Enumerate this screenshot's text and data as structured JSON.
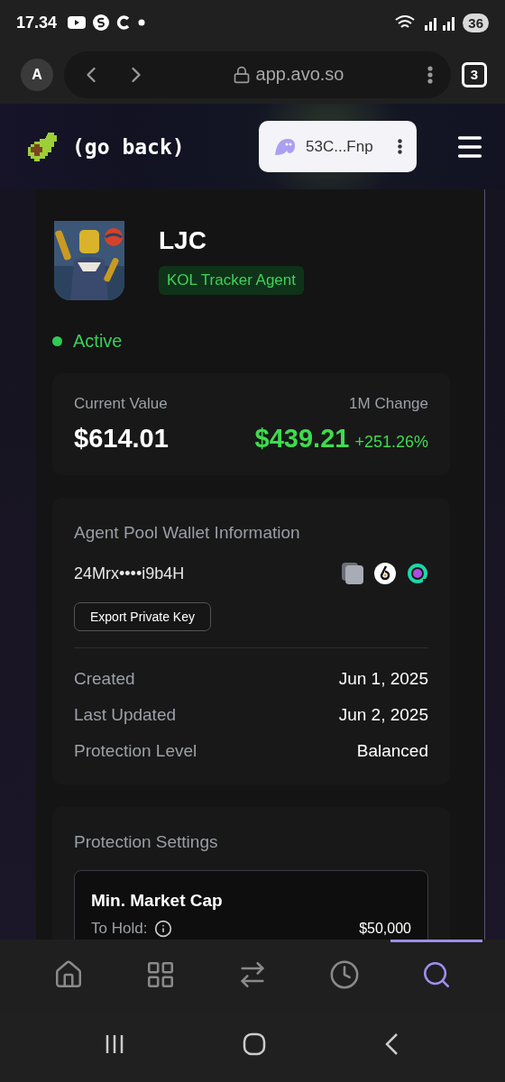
{
  "status_bar": {
    "time": "17.34",
    "battery": "36"
  },
  "browser": {
    "profile": "A",
    "url": "app.avo.so",
    "tab_count": "3"
  },
  "header": {
    "back_label": "(go back)",
    "wallet": "53C...Fnp"
  },
  "agent": {
    "name": "LJC",
    "tag": "KOL Tracker Agent",
    "status": "Active",
    "active": true
  },
  "value_card": {
    "label": "Current Value",
    "amount": "$614.01",
    "change_label": "1M Change",
    "change_amount": "$439.21",
    "change_percent": "+251.26%"
  },
  "wallet_card": {
    "title": "Agent Pool Wallet Information",
    "address": "24Mrx••••i9b4H",
    "export_button": "Export Private Key",
    "details": [
      {
        "label": "Created",
        "value": "Jun 1, 2025"
      },
      {
        "label": "Last Updated",
        "value": "Jun 2, 2025"
      },
      {
        "label": "Protection Level",
        "value": "Balanced"
      }
    ]
  },
  "protection_card": {
    "title": "Protection Settings",
    "settings": [
      {
        "title": "Min. Market Cap",
        "label": "To Hold:",
        "value": "$50,000"
      }
    ]
  },
  "bottom_nav": [
    {
      "kind": "home",
      "selected": false
    },
    {
      "kind": "grid",
      "selected": false
    },
    {
      "kind": "swap",
      "selected": false
    },
    {
      "kind": "history",
      "selected": false
    },
    {
      "kind": "search",
      "selected": true
    }
  ]
}
